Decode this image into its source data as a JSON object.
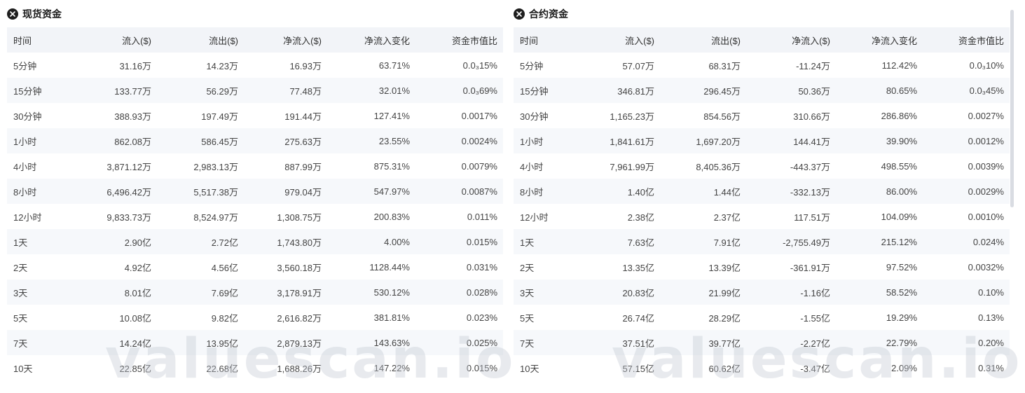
{
  "watermark": "valuescan.io",
  "colors": {
    "positive": "#1bb25a",
    "negative": "#f0304c",
    "header_bg": "#f2f4f8"
  },
  "spot": {
    "title": "现货资金",
    "icon": "close-circle-icon",
    "columns": [
      "时间",
      "流入($)",
      "流出($)",
      "净流入($)",
      "净流入变化",
      "资金市值比"
    ],
    "rows": [
      {
        "time": "5分钟",
        "inflow": "31.16万",
        "outflow": "14.23万",
        "net": "16.93万",
        "net_dir": "pos",
        "change": "63.71%",
        "change_dir": "neg",
        "ratio": "0.0₃15%",
        "ratio_dir": "pos"
      },
      {
        "time": "15分钟",
        "inflow": "133.77万",
        "outflow": "56.29万",
        "net": "77.48万",
        "net_dir": "pos",
        "change": "32.01%",
        "change_dir": "neg",
        "ratio": "0.0₃69%",
        "ratio_dir": "pos"
      },
      {
        "time": "30分钟",
        "inflow": "388.93万",
        "outflow": "197.49万",
        "net": "191.44万",
        "net_dir": "pos",
        "change": "127.41%",
        "change_dir": "pos",
        "ratio": "0.0017%",
        "ratio_dir": "pos"
      },
      {
        "time": "1小时",
        "inflow": "862.08万",
        "outflow": "586.45万",
        "net": "275.63万",
        "net_dir": "pos",
        "change": "23.55%",
        "change_dir": "neg",
        "ratio": "0.0024%",
        "ratio_dir": "pos"
      },
      {
        "time": "4小时",
        "inflow": "3,871.12万",
        "outflow": "2,983.13万",
        "net": "887.99万",
        "net_dir": "pos",
        "change": "875.31%",
        "change_dir": "pos",
        "ratio": "0.0079%",
        "ratio_dir": "pos"
      },
      {
        "time": "8小时",
        "inflow": "6,496.42万",
        "outflow": "5,517.38万",
        "net": "979.04万",
        "net_dir": "pos",
        "change": "547.97%",
        "change_dir": "pos",
        "ratio": "0.0087%",
        "ratio_dir": "pos"
      },
      {
        "time": "12小时",
        "inflow": "9,833.73万",
        "outflow": "8,524.97万",
        "net": "1,308.75万",
        "net_dir": "pos",
        "change": "200.83%",
        "change_dir": "pos",
        "ratio": "0.011%",
        "ratio_dir": "pos"
      },
      {
        "time": "1天",
        "inflow": "2.90亿",
        "outflow": "2.72亿",
        "net": "1,743.80万",
        "net_dir": "pos",
        "change": "4.00%",
        "change_dir": "neg",
        "ratio": "0.015%",
        "ratio_dir": "pos"
      },
      {
        "time": "2天",
        "inflow": "4.92亿",
        "outflow": "4.56亿",
        "net": "3,560.18万",
        "net_dir": "pos",
        "change": "1128.44%",
        "change_dir": "pos",
        "ratio": "0.031%",
        "ratio_dir": "pos"
      },
      {
        "time": "3天",
        "inflow": "8.01亿",
        "outflow": "7.69亿",
        "net": "3,178.91万",
        "net_dir": "pos",
        "change": "530.12%",
        "change_dir": "pos",
        "ratio": "0.028%",
        "ratio_dir": "pos"
      },
      {
        "time": "5天",
        "inflow": "10.08亿",
        "outflow": "9.82亿",
        "net": "2,616.82万",
        "net_dir": "pos",
        "change": "381.81%",
        "change_dir": "pos",
        "ratio": "0.023%",
        "ratio_dir": "pos"
      },
      {
        "time": "7天",
        "inflow": "14.24亿",
        "outflow": "13.95亿",
        "net": "2,879.13万",
        "net_dir": "pos",
        "change": "143.63%",
        "change_dir": "pos",
        "ratio": "0.025%",
        "ratio_dir": "pos"
      },
      {
        "time": "10天",
        "inflow": "22.85亿",
        "outflow": "22.68亿",
        "net": "1,688.26万",
        "net_dir": "pos",
        "change": "147.22%",
        "change_dir": "pos",
        "ratio": "0.015%",
        "ratio_dir": "pos"
      }
    ]
  },
  "contract": {
    "title": "合约资金",
    "icon": "close-circle-icon",
    "columns": [
      "时间",
      "流入($)",
      "流出($)",
      "净流入($)",
      "净流入变化",
      "资金市值比"
    ],
    "rows": [
      {
        "time": "5分钟",
        "inflow": "57.07万",
        "outflow": "68.31万",
        "net": "-11.24万",
        "net_dir": "neg",
        "change": "112.42%",
        "change_dir": "neg",
        "ratio": "0.0₃10%",
        "ratio_dir": "neg"
      },
      {
        "time": "15分钟",
        "inflow": "346.81万",
        "outflow": "296.45万",
        "net": "50.36万",
        "net_dir": "pos",
        "change": "80.65%",
        "change_dir": "neg",
        "ratio": "0.0₃45%",
        "ratio_dir": "pos"
      },
      {
        "time": "30分钟",
        "inflow": "1,165.23万",
        "outflow": "854.56万",
        "net": "310.66万",
        "net_dir": "pos",
        "change": "286.86%",
        "change_dir": "pos",
        "ratio": "0.0027%",
        "ratio_dir": "pos"
      },
      {
        "time": "1小时",
        "inflow": "1,841.61万",
        "outflow": "1,697.20万",
        "net": "144.41万",
        "net_dir": "pos",
        "change": "39.90%",
        "change_dir": "neg",
        "ratio": "0.0012%",
        "ratio_dir": "pos"
      },
      {
        "time": "4小时",
        "inflow": "7,961.99万",
        "outflow": "8,405.36万",
        "net": "-443.37万",
        "net_dir": "neg",
        "change": "498.55%",
        "change_dir": "neg",
        "ratio": "0.0039%",
        "ratio_dir": "neg"
      },
      {
        "time": "8小时",
        "inflow": "1.40亿",
        "outflow": "1.44亿",
        "net": "-332.13万",
        "net_dir": "neg",
        "change": "86.00%",
        "change_dir": "pos",
        "ratio": "0.0029%",
        "ratio_dir": "neg"
      },
      {
        "time": "12小时",
        "inflow": "2.38亿",
        "outflow": "2.37亿",
        "net": "117.51万",
        "net_dir": "pos",
        "change": "104.09%",
        "change_dir": "pos",
        "ratio": "0.0010%",
        "ratio_dir": "pos"
      },
      {
        "time": "1天",
        "inflow": "7.63亿",
        "outflow": "7.91亿",
        "net": "-2,755.49万",
        "net_dir": "neg",
        "change": "215.12%",
        "change_dir": "neg",
        "ratio": "0.024%",
        "ratio_dir": "neg"
      },
      {
        "time": "2天",
        "inflow": "13.35亿",
        "outflow": "13.39亿",
        "net": "-361.91万",
        "net_dir": "neg",
        "change": "97.52%",
        "change_dir": "pos",
        "ratio": "0.0032%",
        "ratio_dir": "neg"
      },
      {
        "time": "3天",
        "inflow": "20.83亿",
        "outflow": "21.99亿",
        "net": "-1.16亿",
        "net_dir": "neg",
        "change": "58.52%",
        "change_dir": "neg",
        "ratio": "0.10%",
        "ratio_dir": "neg"
      },
      {
        "time": "5天",
        "inflow": "26.74亿",
        "outflow": "28.29亿",
        "net": "-1.55亿",
        "net_dir": "neg",
        "change": "19.29%",
        "change_dir": "pos",
        "ratio": "0.13%",
        "ratio_dir": "neg"
      },
      {
        "time": "7天",
        "inflow": "37.51亿",
        "outflow": "39.77亿",
        "net": "-2.27亿",
        "net_dir": "neg",
        "change": "22.79%",
        "change_dir": "pos",
        "ratio": "0.20%",
        "ratio_dir": "neg"
      },
      {
        "time": "10天",
        "inflow": "57.15亿",
        "outflow": "60.62亿",
        "net": "-3.47亿",
        "net_dir": "neg",
        "change": "2.09%",
        "change_dir": "pos",
        "ratio": "0.31%",
        "ratio_dir": "neg"
      }
    ]
  }
}
